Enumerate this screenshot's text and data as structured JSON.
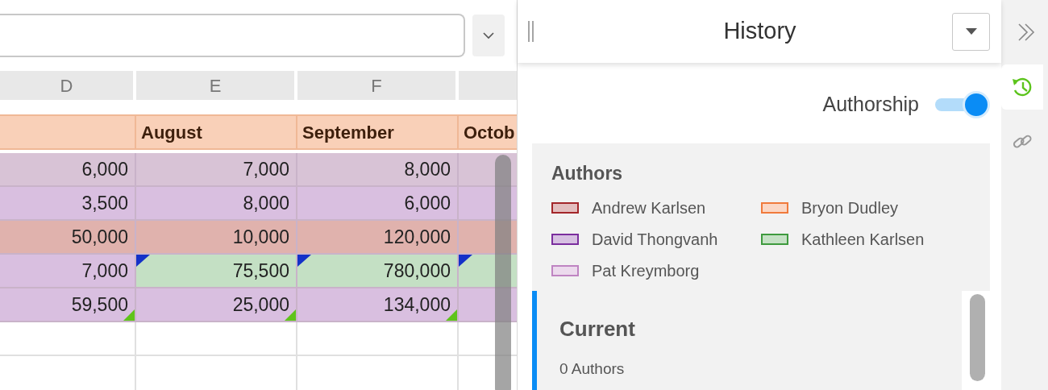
{
  "sheet": {
    "column_letters": [
      "D",
      "E",
      "F"
    ],
    "header_cells": [
      {
        "text": ""
      },
      {
        "text": "August"
      },
      {
        "text": "September"
      },
      {
        "text": "Octob"
      }
    ],
    "rows": [
      {
        "cells": [
          {
            "text": "6,000",
            "color": "#d8c3d6",
            "comment": false,
            "changed": false
          },
          {
            "text": "7,000",
            "color": "#d8c3d6",
            "comment": false,
            "changed": false
          },
          {
            "text": "8,000",
            "color": "#d8c3d6",
            "comment": false,
            "changed": false
          },
          {
            "color": "#d8c3d6",
            "comment": false,
            "changed": false
          }
        ]
      },
      {
        "cells": [
          {
            "text": "3,500",
            "color": "#d9bfe0",
            "comment": false,
            "changed": false
          },
          {
            "text": "8,000",
            "color": "#d9bfe0",
            "comment": false,
            "changed": false
          },
          {
            "text": "6,000",
            "color": "#d9bfe0",
            "comment": false,
            "changed": false
          },
          {
            "color": "#d9bfe0",
            "comment": false,
            "changed": false
          }
        ]
      },
      {
        "cells": [
          {
            "text": "50,000",
            "color": "#e0b2ad",
            "comment": false,
            "changed": false
          },
          {
            "text": "10,000",
            "color": "#e0b2ad",
            "comment": false,
            "changed": false
          },
          {
            "text": "120,000",
            "color": "#e0b2ad",
            "comment": false,
            "changed": false
          },
          {
            "color": "#e0b2ad",
            "comment": false,
            "changed": false
          }
        ]
      },
      {
        "cells": [
          {
            "text": "7,000",
            "color": "#d9bfe0",
            "comment": false,
            "changed": false
          },
          {
            "text": "75,500",
            "color": "#c4e0c4",
            "comment": true,
            "changed": false
          },
          {
            "text": "780,000",
            "color": "#c4e0c4",
            "comment": true,
            "changed": false
          },
          {
            "color": "#c4e0c4",
            "comment": true,
            "changed": false
          }
        ]
      },
      {
        "cells": [
          {
            "text": "59,500",
            "color": "#d9bfe0",
            "comment": false,
            "changed": true
          },
          {
            "text": "25,000",
            "color": "#d9bfe0",
            "comment": false,
            "changed": true
          },
          {
            "text": "134,000",
            "color": "#d9bfe0",
            "comment": false,
            "changed": true
          },
          {
            "color": "#d9bfe0",
            "comment": false,
            "changed": false
          }
        ]
      }
    ]
  },
  "panel": {
    "title": "History",
    "toggle": {
      "label": "Authorship",
      "on": true
    },
    "authors_title": "Authors",
    "authors": [
      {
        "name": "Andrew Karlsen",
        "color": "#a3262a"
      },
      {
        "name": "Bryon Dudley",
        "color": "#f07a3c"
      },
      {
        "name": "David Thongvanh",
        "color": "#7b2e9e"
      },
      {
        "name": "Kathleen Karlsen",
        "color": "#3e9a3e"
      },
      {
        "name": "Pat Kreymborg",
        "color": "#bf84c2"
      }
    ],
    "versions": [
      {
        "title": "Current",
        "count": "0 Authors",
        "selected": true
      }
    ]
  },
  "side_tabs": [
    {
      "kind": "history",
      "selected": true
    },
    {
      "kind": "link",
      "selected": false
    }
  ]
}
